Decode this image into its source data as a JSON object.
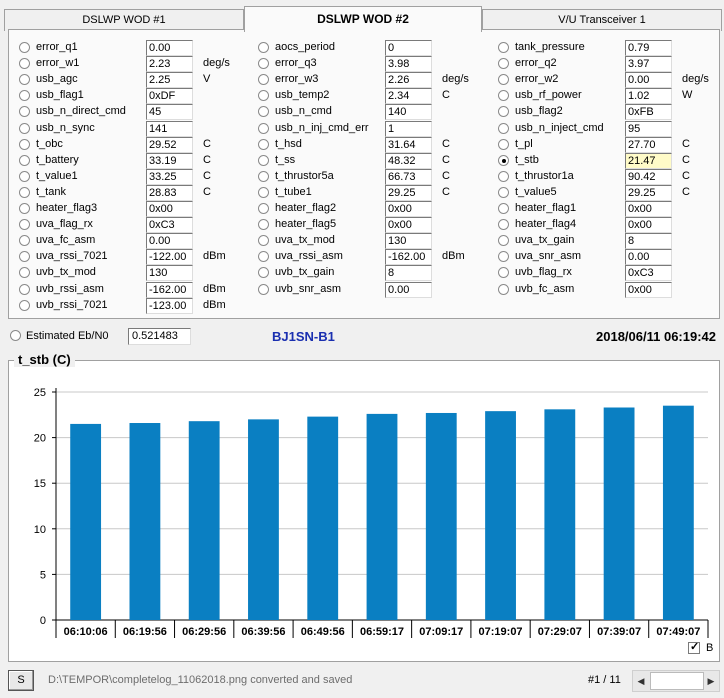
{
  "tabs": [
    {
      "label": "DSLWP WOD #1"
    },
    {
      "label": "DSLWP WOD #2"
    },
    {
      "label": "V/U Transceiver 1"
    }
  ],
  "columns": [
    [
      {
        "label": "error_q1",
        "value": "0.00",
        "unit": ""
      },
      {
        "label": "error_w1",
        "value": "2.23",
        "unit": "deg/s"
      },
      {
        "label": "usb_agc",
        "value": "2.25",
        "unit": "V"
      },
      {
        "label": "usb_flag1",
        "value": "0xDF",
        "unit": ""
      },
      {
        "label": "usb_n_direct_cmd",
        "value": "45",
        "unit": ""
      },
      {
        "label": "usb_n_sync",
        "value": "141",
        "unit": ""
      },
      {
        "label": "t_obc",
        "value": "29.52",
        "unit": "C"
      },
      {
        "label": "t_battery",
        "value": "33.19",
        "unit": "C"
      },
      {
        "label": "t_value1",
        "value": "33.25",
        "unit": "C"
      },
      {
        "label": "t_tank",
        "value": "28.83",
        "unit": "C"
      },
      {
        "label": "heater_flag3",
        "value": "0x00",
        "unit": ""
      },
      {
        "label": "uva_flag_rx",
        "value": "0xC3",
        "unit": ""
      },
      {
        "label": "uva_fc_asm",
        "value": "0.00",
        "unit": ""
      },
      {
        "label": "uva_rssi_7021",
        "value": "-122.00",
        "unit": "dBm"
      },
      {
        "label": "uvb_tx_mod",
        "value": "130",
        "unit": ""
      },
      {
        "label": "uvb_rssi_asm",
        "value": "-162.00",
        "unit": "dBm"
      },
      {
        "label": "uvb_rssi_7021",
        "value": "-123.00",
        "unit": "dBm"
      }
    ],
    [
      {
        "label": "aocs_period",
        "value": "0",
        "unit": ""
      },
      {
        "label": "error_q3",
        "value": "3.98",
        "unit": ""
      },
      {
        "label": "error_w3",
        "value": "2.26",
        "unit": "deg/s"
      },
      {
        "label": "usb_temp2",
        "value": "2.34",
        "unit": "C"
      },
      {
        "label": "usb_n_cmd",
        "value": "140",
        "unit": ""
      },
      {
        "label": "usb_n_inj_cmd_err",
        "value": "1",
        "unit": ""
      },
      {
        "label": "t_hsd",
        "value": "31.64",
        "unit": "C"
      },
      {
        "label": "t_ss",
        "value": "48.32",
        "unit": "C"
      },
      {
        "label": "t_thrustor5a",
        "value": "66.73",
        "unit": "C"
      },
      {
        "label": "t_tube1",
        "value": "29.25",
        "unit": "C"
      },
      {
        "label": "heater_flag2",
        "value": "0x00",
        "unit": ""
      },
      {
        "label": "heater_flag5",
        "value": "0x00",
        "unit": ""
      },
      {
        "label": "uva_tx_mod",
        "value": "130",
        "unit": ""
      },
      {
        "label": "uva_rssi_asm",
        "value": "-162.00",
        "unit": "dBm"
      },
      {
        "label": "uvb_tx_gain",
        "value": "8",
        "unit": ""
      },
      {
        "label": "uvb_snr_asm",
        "value": "0.00",
        "unit": ""
      }
    ],
    [
      {
        "label": "tank_pressure",
        "value": "0.79",
        "unit": ""
      },
      {
        "label": "error_q2",
        "value": "3.97",
        "unit": ""
      },
      {
        "label": "error_w2",
        "value": "0.00",
        "unit": "deg/s"
      },
      {
        "label": "usb_rf_power",
        "value": "1.02",
        "unit": "W"
      },
      {
        "label": "usb_flag2",
        "value": "0xFB",
        "unit": ""
      },
      {
        "label": "usb_n_inject_cmd",
        "value": "95",
        "unit": ""
      },
      {
        "label": "t_pl",
        "value": "27.70",
        "unit": "C"
      },
      {
        "label": "t_stb",
        "value": "21.47",
        "unit": "C",
        "selected": true
      },
      {
        "label": "t_thrustor1a",
        "value": "90.42",
        "unit": "C"
      },
      {
        "label": "t_value5",
        "value": "29.25",
        "unit": "C"
      },
      {
        "label": "heater_flag1",
        "value": "0x00",
        "unit": ""
      },
      {
        "label": "heater_flag4",
        "value": "0x00",
        "unit": ""
      },
      {
        "label": "uva_tx_gain",
        "value": "8",
        "unit": ""
      },
      {
        "label": "uva_snr_asm",
        "value": "0.00",
        "unit": ""
      },
      {
        "label": "uvb_flag_rx",
        "value": "0xC3",
        "unit": ""
      },
      {
        "label": "uvb_fc_asm",
        "value": "0x00",
        "unit": ""
      }
    ]
  ],
  "eb": {
    "label": "Estimated Eb/N0",
    "value": "0.521483"
  },
  "callsign": "BJ1SN-B1",
  "datetime": "2018/06/11 06:19:42",
  "chart_title": "t_stb (C)",
  "chart_data": {
    "type": "bar",
    "categories": [
      "06:10:06",
      "06:19:56",
      "06:29:56",
      "06:39:56",
      "06:49:56",
      "06:59:17",
      "07:09:17",
      "07:19:07",
      "07:29:07",
      "07:39:07",
      "07:49:07"
    ],
    "series": [
      {
        "name": "B",
        "values": [
          21.5,
          21.6,
          21.8,
          22.0,
          22.3,
          22.6,
          22.7,
          22.9,
          23.1,
          23.3,
          23.5
        ]
      }
    ],
    "yticks": [
      0,
      5,
      10,
      15,
      20,
      25
    ],
    "ylim": [
      0,
      25
    ],
    "grid": true,
    "bar_color": "#0a7fc2",
    "legend_checked": true
  },
  "status": {
    "button": "S",
    "message": "D:\\TEMPOR\\completelog_11062018.png converted and saved",
    "page": "#1 / 11"
  }
}
